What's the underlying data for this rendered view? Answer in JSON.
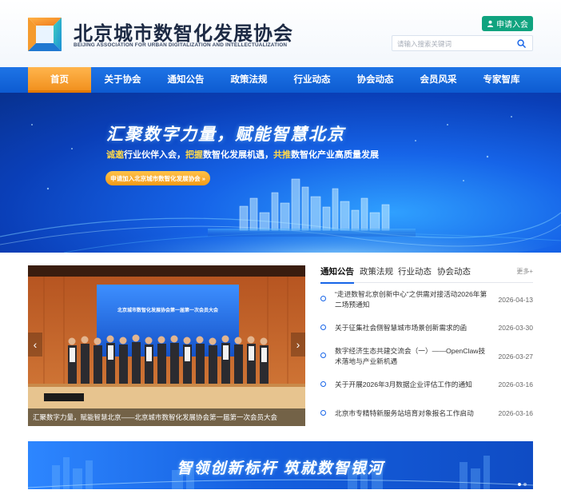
{
  "header": {
    "org_name_cn": "北京城市数智化发展协会",
    "org_name_en": "BEIJING ASSOCIATION FOR URBAN DIGITALIZATION AND INTELLECTUALIZATION",
    "apply_label": "申请入会",
    "search_placeholder": "请输入搜索关键词"
  },
  "nav": {
    "items": [
      {
        "label": "首页",
        "active": true
      },
      {
        "label": "关于协会"
      },
      {
        "label": "通知公告"
      },
      {
        "label": "政策法规"
      },
      {
        "label": "行业动态"
      },
      {
        "label": "协会动态"
      },
      {
        "label": "会员风采"
      },
      {
        "label": "专家智库"
      }
    ]
  },
  "banner": {
    "title": "汇聚数字力量，赋能智慧北京",
    "sub_hl_1": "诚邀",
    "sub_1": "行业伙伴入会，",
    "sub_hl_2": "把握",
    "sub_2": "数智化发展机遇，",
    "sub_hl_3": "共推",
    "sub_3": "数智化产业高质量发展",
    "cta": "申请加入北京城市数智化发展协会 »"
  },
  "carousel": {
    "stage_text": "北京城市数智化发展协会第一届第一次会员大会",
    "caption": "汇聚数字力量，赋能智慧北京——北京城市数智化发展协会第一届第一次会员大会",
    "prev": "‹",
    "next": "›"
  },
  "news": {
    "tabs": [
      "通知公告",
      "政策法规",
      "行业动态",
      "协会动态"
    ],
    "more": "更多+",
    "items": [
      {
        "title": "“走进数智北京创新中心”之供需对接活动2026年第二场预通知",
        "date": "2026-04-13"
      },
      {
        "title": "关于征集社会侧智慧城市场景创新需求的函",
        "date": "2026-03-30"
      },
      {
        "title": "数字经济生态共建交流会（一）——OpenClaw技术落地与产业新机遇",
        "date": "2026-03-27"
      },
      {
        "title": "关于开展2026年3月数据企业评估工作的通知",
        "date": "2026-03-16"
      },
      {
        "title": "北京市专精特新服务站培育对象报名工作启动",
        "date": "2026-03-16"
      }
    ]
  },
  "bottom_banner": {
    "text": "智领创新标杆  筑就数智银河"
  },
  "colors": {
    "primary": "#1664e8",
    "accent": "#f39a17",
    "green": "#10a37f"
  }
}
